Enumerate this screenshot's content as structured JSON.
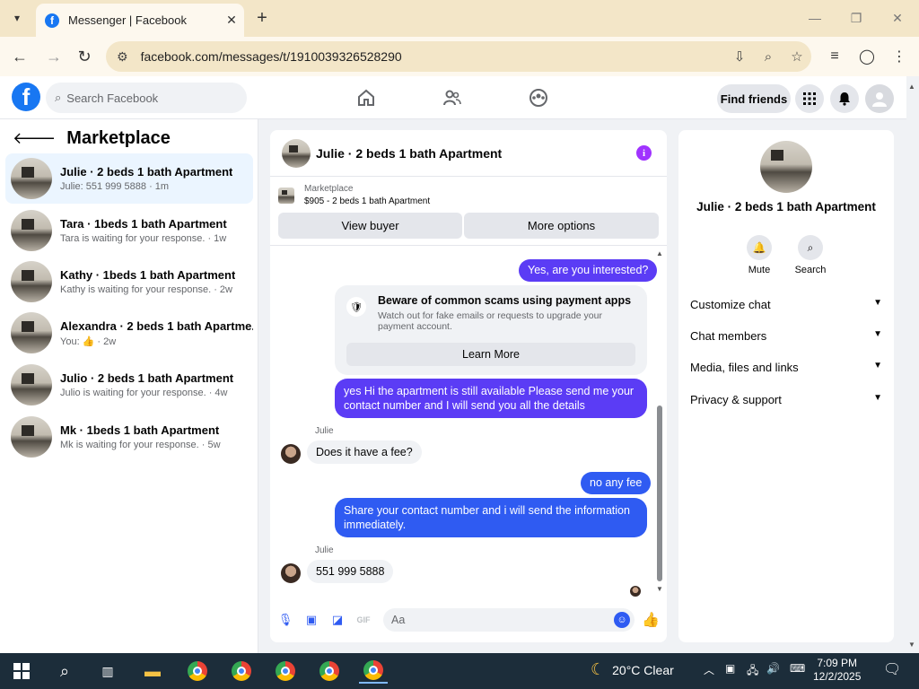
{
  "browser": {
    "tab_title": "Messenger | Facebook",
    "url": "facebook.com/messages/t/1910039326528290",
    "icons": [
      "tab-search-icon",
      "close-icon",
      "new-tab-icon",
      "minimize-icon",
      "maximize-icon",
      "window-close-icon",
      "back-icon",
      "forward-icon",
      "reload-icon",
      "site-info-icon",
      "install-icon",
      "zoom-icon",
      "bookmark-star-icon",
      "media-icon",
      "profile-icon",
      "menu-icon"
    ]
  },
  "fb_header": {
    "logo": "f",
    "search_placeholder": "Search Facebook",
    "find_friends": "Find friends"
  },
  "sidebar": {
    "title": "Marketplace",
    "conversations": [
      {
        "name": "Julie · 2 beds 1 bath Apartment",
        "sub": "Julie: 551 999 5888 · 1m",
        "active": true
      },
      {
        "name": "Tara · 1beds 1 bath Apartment",
        "sub": "Tara is waiting for your response. · 1w"
      },
      {
        "name": "Kathy · 1beds 1 bath Apartment",
        "sub": "Kathy is waiting for your response. · 2w"
      },
      {
        "name": "Alexandra · 2 beds 1 bath Apartme...",
        "sub": "You: 👍 · 2w"
      },
      {
        "name": "Julio · 2 beds 1 bath Apartment",
        "sub": "Julio is waiting for your response. · 4w"
      },
      {
        "name": "Mk · 1beds 1 bath Apartment",
        "sub": "Mk is waiting for your response. · 5w"
      }
    ]
  },
  "chat": {
    "title": "Julie · 2 beds 1 bath Apartment",
    "marketplace_label": "Marketplace",
    "listing": "$905 - 2 beds 1 bath Apartment",
    "view_buyer": "View buyer",
    "more_options": "More options",
    "messages": {
      "m1": "Yes, are you interested?",
      "scam_title": "Beware of common scams using payment apps",
      "scam_desc": "Watch out for fake emails or requests to upgrade your payment account.",
      "learn_more": "Learn More",
      "m2": "yes Hi the apartment is still available Please send me your contact number and I will send you all the details",
      "sender1": "Julie",
      "m3": "Does it have a fee?",
      "m4": "no any fee",
      "m5": "Share your contact number and i will send the information immediately.",
      "sender2": "Julie",
      "m6": "551 999 5888"
    },
    "composer_placeholder": "Aa"
  },
  "right_panel": {
    "name": "Julie · 2 beds 1 bath Apartment",
    "mute": "Mute",
    "search": "Search",
    "rows": [
      "Customize chat",
      "Chat members",
      "Media, files and links",
      "Privacy & support"
    ]
  },
  "taskbar": {
    "weather": "20°C  Clear",
    "time": "7:09 PM",
    "date": "12/2/2025"
  },
  "colors": {
    "fb_blue": "#1877f2",
    "outgoing_purple": "#5b3cf5",
    "outgoing_blue": "#2f5bf2",
    "active_row": "#ebf5ff",
    "taskbar": "#1c2d3a"
  }
}
